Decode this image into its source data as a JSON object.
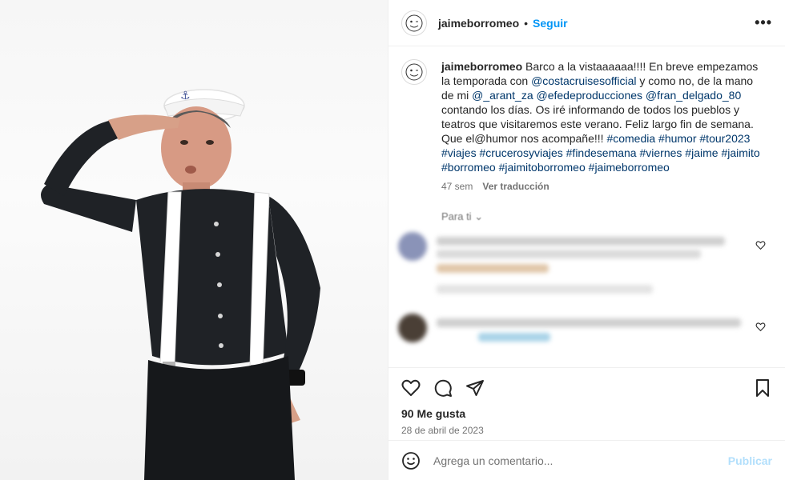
{
  "post": {
    "username": "jaimeborromeo",
    "follow_label": "Seguir",
    "dot": "•",
    "more_label": "•••"
  },
  "caption": {
    "username": "jaimeborromeo",
    "parts": [
      {
        "text": " Barco a la vistaaaaaa!!!! En breve empezamos la temporada con ",
        "link": false
      },
      {
        "text": "@costacruisesofficial",
        "link": true
      },
      {
        "text": " y como no, de la mano de mi ",
        "link": false
      },
      {
        "text": "@_arant_za",
        "link": true
      },
      {
        "text": " ",
        "link": false
      },
      {
        "text": "@efedeproducciones",
        "link": true
      },
      {
        "text": " ",
        "link": false
      },
      {
        "text": "@fran_delgado_80",
        "link": true
      },
      {
        "text": " contando los días. Os iré informando de todos los pueblos y teatros que visitaremos este verano. Feliz largo fin de semana. Que el@humor nos acompañe!!! ",
        "link": false
      },
      {
        "text": "#comedia",
        "link": true
      },
      {
        "text": " ",
        "link": false
      },
      {
        "text": "#humor",
        "link": true
      },
      {
        "text": " ",
        "link": false
      },
      {
        "text": "#tour2023",
        "link": true
      },
      {
        "text": " ",
        "link": false
      },
      {
        "text": "#viajes",
        "link": true
      },
      {
        "text": " ",
        "link": false
      },
      {
        "text": "#crucerosyviajes",
        "link": true
      },
      {
        "text": " ",
        "link": false
      },
      {
        "text": "#findesemana",
        "link": true
      },
      {
        "text": " ",
        "link": false
      },
      {
        "text": "#viernes",
        "link": true
      },
      {
        "text": " ",
        "link": false
      },
      {
        "text": "#jaime",
        "link": true
      },
      {
        "text": " ",
        "link": false
      },
      {
        "text": "#jaimito",
        "link": true
      },
      {
        "text": " ",
        "link": false
      },
      {
        "text": "#borromeo",
        "link": true
      },
      {
        "text": " ",
        "link": false
      },
      {
        "text": "#jaimitoborromeo",
        "link": true
      },
      {
        "text": " ",
        "link": false
      },
      {
        "text": "#jaimeborromeo",
        "link": true
      }
    ],
    "age": "47 sem",
    "translate_label": "Ver traducción"
  },
  "for_you_label": "Para ti",
  "stats": {
    "likes": "90 Me gusta",
    "date": "28 de abril de 2023"
  },
  "composer": {
    "placeholder": "Agrega un comentario...",
    "publish_label": "Publicar"
  },
  "colors": {
    "link": "#00376b",
    "follow": "#0095f6",
    "publish_disabled": "#b2dffc"
  }
}
